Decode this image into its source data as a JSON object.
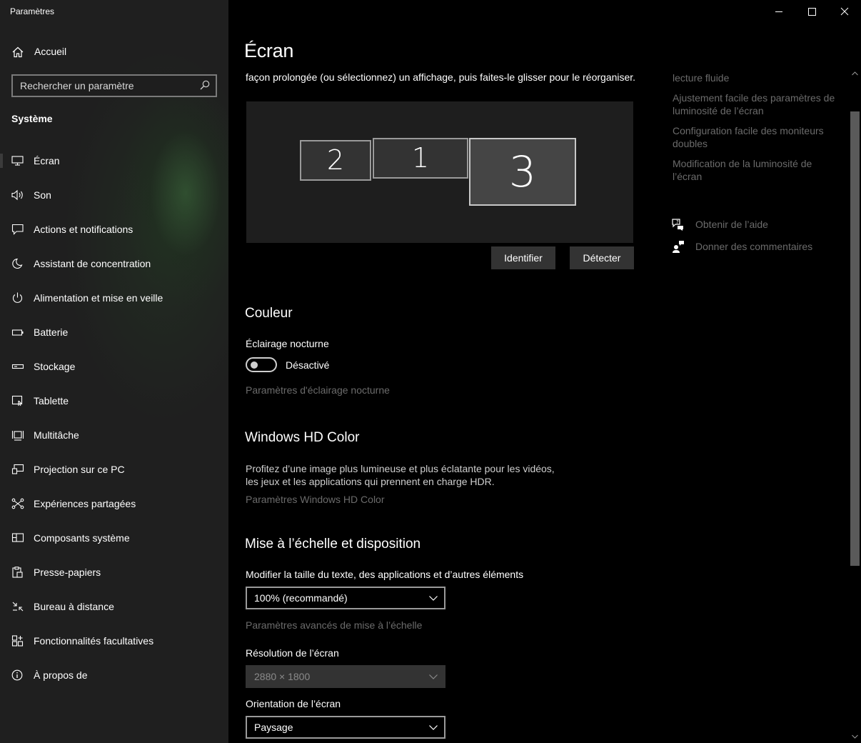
{
  "window": {
    "title": "Paramètres",
    "minimize_icon": "minimize-icon",
    "maximize_icon": "maximize-icon",
    "close_icon": "close-icon"
  },
  "sidebar": {
    "home_label": "Accueil",
    "search_placeholder": "Rechercher un paramètre",
    "section": "Système",
    "items": [
      {
        "label": "Écran",
        "icon": "monitor-icon",
        "active": true
      },
      {
        "label": "Son",
        "icon": "speaker-icon"
      },
      {
        "label": "Actions et notifications",
        "icon": "notification-icon"
      },
      {
        "label": "Assistant de concentration",
        "icon": "moon-icon"
      },
      {
        "label": "Alimentation et mise en veille",
        "icon": "power-icon"
      },
      {
        "label": "Batterie",
        "icon": "battery-icon"
      },
      {
        "label": "Stockage",
        "icon": "storage-icon"
      },
      {
        "label": "Tablette",
        "icon": "tablet-icon"
      },
      {
        "label": "Multitâche",
        "icon": "multitask-icon"
      },
      {
        "label": "Projection sur ce PC",
        "icon": "projection-icon"
      },
      {
        "label": "Expériences partagées",
        "icon": "shared-icon"
      },
      {
        "label": "Composants système",
        "icon": "components-icon"
      },
      {
        "label": "Presse-papiers",
        "icon": "clipboard-icon"
      },
      {
        "label": "Bureau à distance",
        "icon": "remote-desktop-icon"
      },
      {
        "label": "Fonctionnalités facultatives",
        "icon": "features-icon"
      },
      {
        "label": "À propos de",
        "icon": "info-icon"
      }
    ]
  },
  "main": {
    "title": "Écran",
    "intro_visible": "façon prolongée (ou sélectionnez) un affichage, puis faites-le glisser pour le réorganiser.",
    "monitors": [
      "2",
      "1",
      "3"
    ],
    "identify_button": "Identifier",
    "detect_button": "Détecter",
    "color": {
      "heading": "Couleur",
      "night_light_label": "Éclairage nocturne",
      "night_light_state": "Désactivé",
      "night_light_link": "Paramètres d'éclairage nocturne"
    },
    "hdr": {
      "heading": "Windows HD Color",
      "desc_line1": "Profitez d’une image plus lumineuse et plus éclatante pour les vidéos,",
      "desc_line2": "les jeux et les applications qui prennent en charge HDR.",
      "link": "Paramètres Windows HD Color"
    },
    "scale": {
      "heading": "Mise à l’échelle et disposition",
      "size_label": "Modifier la taille du texte, des applications et d’autres éléments",
      "size_value": "100% (recommandé)",
      "advanced_link": "Paramètres avancés de mise à l’échelle",
      "resolution_label": "Résolution de l’écran",
      "resolution_value": "2880 × 1800",
      "orientation_label": "Orientation de l’écran",
      "orientation_value": "Paysage"
    }
  },
  "related": {
    "links": [
      {
        "line1": "lecture fluide"
      },
      {
        "line1": "Ajustement facile des paramètres de",
        "line2": "luminosité de l’écran"
      },
      {
        "line1": "Configuration facile des moniteurs",
        "line2": "doubles"
      },
      {
        "line1": "Modification de la luminosité de",
        "line2": "l’écran"
      }
    ],
    "help": "Obtenir de l’aide",
    "feedback": "Donner des commentaires"
  }
}
